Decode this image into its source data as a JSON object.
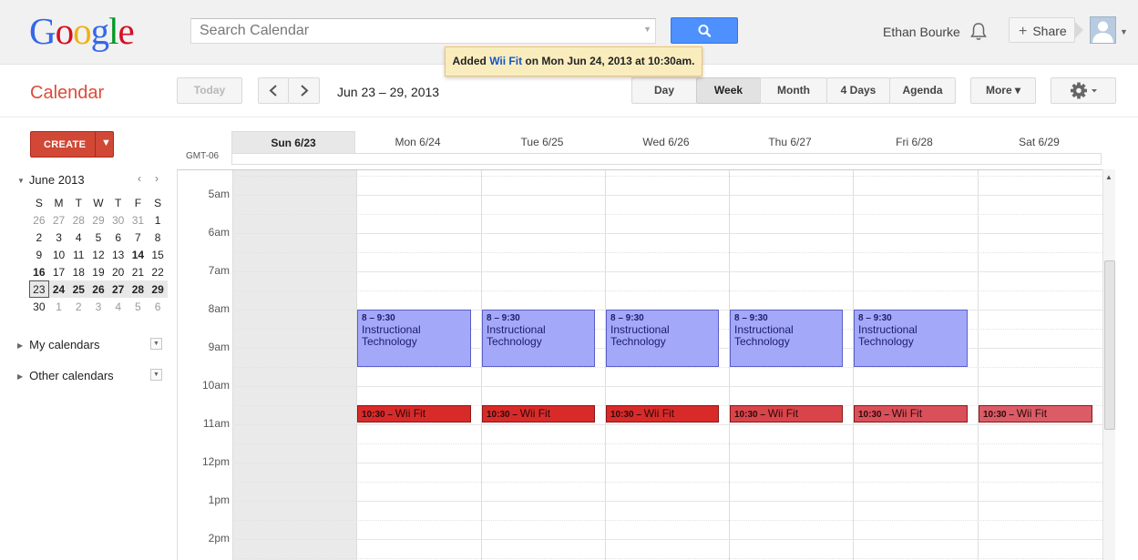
{
  "header": {
    "logo": "Google",
    "search_placeholder": "Search Calendar",
    "user_name": "Ethan Bourke",
    "share_label": "Share"
  },
  "toast": {
    "prefix": "Added ",
    "event_link": "Wii Fit",
    "suffix": " on Mon Jun 24, 2013 at 10:30am."
  },
  "toolbar": {
    "app_title": "Calendar",
    "today_label": "Today",
    "date_range": "Jun 23 – 29, 2013",
    "views": [
      "Day",
      "Week",
      "Month",
      "4 Days",
      "Agenda"
    ],
    "selected_view": "Week",
    "more_label": "More ▾"
  },
  "sidebar": {
    "create_label": "CREATE",
    "mini_calendar": {
      "month_label": "June 2013",
      "weekdays": [
        "S",
        "M",
        "T",
        "W",
        "T",
        "F",
        "S"
      ],
      "weeks": [
        [
          "26",
          "27",
          "28",
          "29",
          "30",
          "31",
          "1"
        ],
        [
          "2",
          "3",
          "4",
          "5",
          "6",
          "7",
          "8"
        ],
        [
          "9",
          "10",
          "11",
          "12",
          "13",
          "14",
          "15"
        ],
        [
          "16",
          "17",
          "18",
          "19",
          "20",
          "21",
          "22"
        ],
        [
          "23",
          "24",
          "25",
          "26",
          "27",
          "28",
          "29"
        ],
        [
          "30",
          "1",
          "2",
          "3",
          "4",
          "5",
          "6"
        ]
      ]
    },
    "my_calendars_label": "My calendars",
    "other_calendars_label": "Other calendars"
  },
  "week": {
    "timezone": "GMT-06",
    "days": [
      "Sun 6/23",
      "Mon 6/24",
      "Tue 6/25",
      "Wed 6/26",
      "Thu 6/27",
      "Fri 6/28",
      "Sat 6/29"
    ],
    "hours": [
      "5am",
      "6am",
      "7am",
      "8am",
      "9am",
      "10am",
      "11am",
      "12pm",
      "1pm",
      "2pm"
    ],
    "events": [
      {
        "day": 1,
        "time": "8 – 9:30",
        "title": "Instructional Technology",
        "color": "#a4a8f8"
      },
      {
        "day": 2,
        "time": "8 – 9:30",
        "title": "Instructional Technology",
        "color": "#a4a8f8"
      },
      {
        "day": 3,
        "time": "8 – 9:30",
        "title": "Instructional Technology",
        "color": "#a4a8f8"
      },
      {
        "day": 4,
        "time": "8 – 9:30",
        "title": "Instructional Technology",
        "color": "#a4a8f8"
      },
      {
        "day": 5,
        "time": "8 – 9:30",
        "title": "Instructional Technology",
        "color": "#a4a8f8"
      },
      {
        "day": 1,
        "time": "10:30",
        "title": "Wii Fit",
        "color": "#d92a2a"
      },
      {
        "day": 2,
        "time": "10:30",
        "title": "Wii Fit",
        "color": "#d92a2a"
      },
      {
        "day": 3,
        "time": "10:30",
        "title": "Wii Fit",
        "color": "#d92a2a"
      },
      {
        "day": 4,
        "time": "10:30",
        "title": "Wii Fit",
        "color": "#d9444a"
      },
      {
        "day": 5,
        "time": "10:30",
        "title": "Wii Fit",
        "color": "#d9505a"
      },
      {
        "day": 6,
        "time": "10:30",
        "title": "Wii Fit",
        "color": "#db5c66"
      }
    ]
  },
  "colors": {
    "logo_letters": [
      "#3369e8",
      "#d50f25",
      "#eeb211",
      "#3369e8",
      "#009925",
      "#d50f25"
    ],
    "accent_red": "#dd4b39",
    "search_blue": "#4d90fe"
  }
}
